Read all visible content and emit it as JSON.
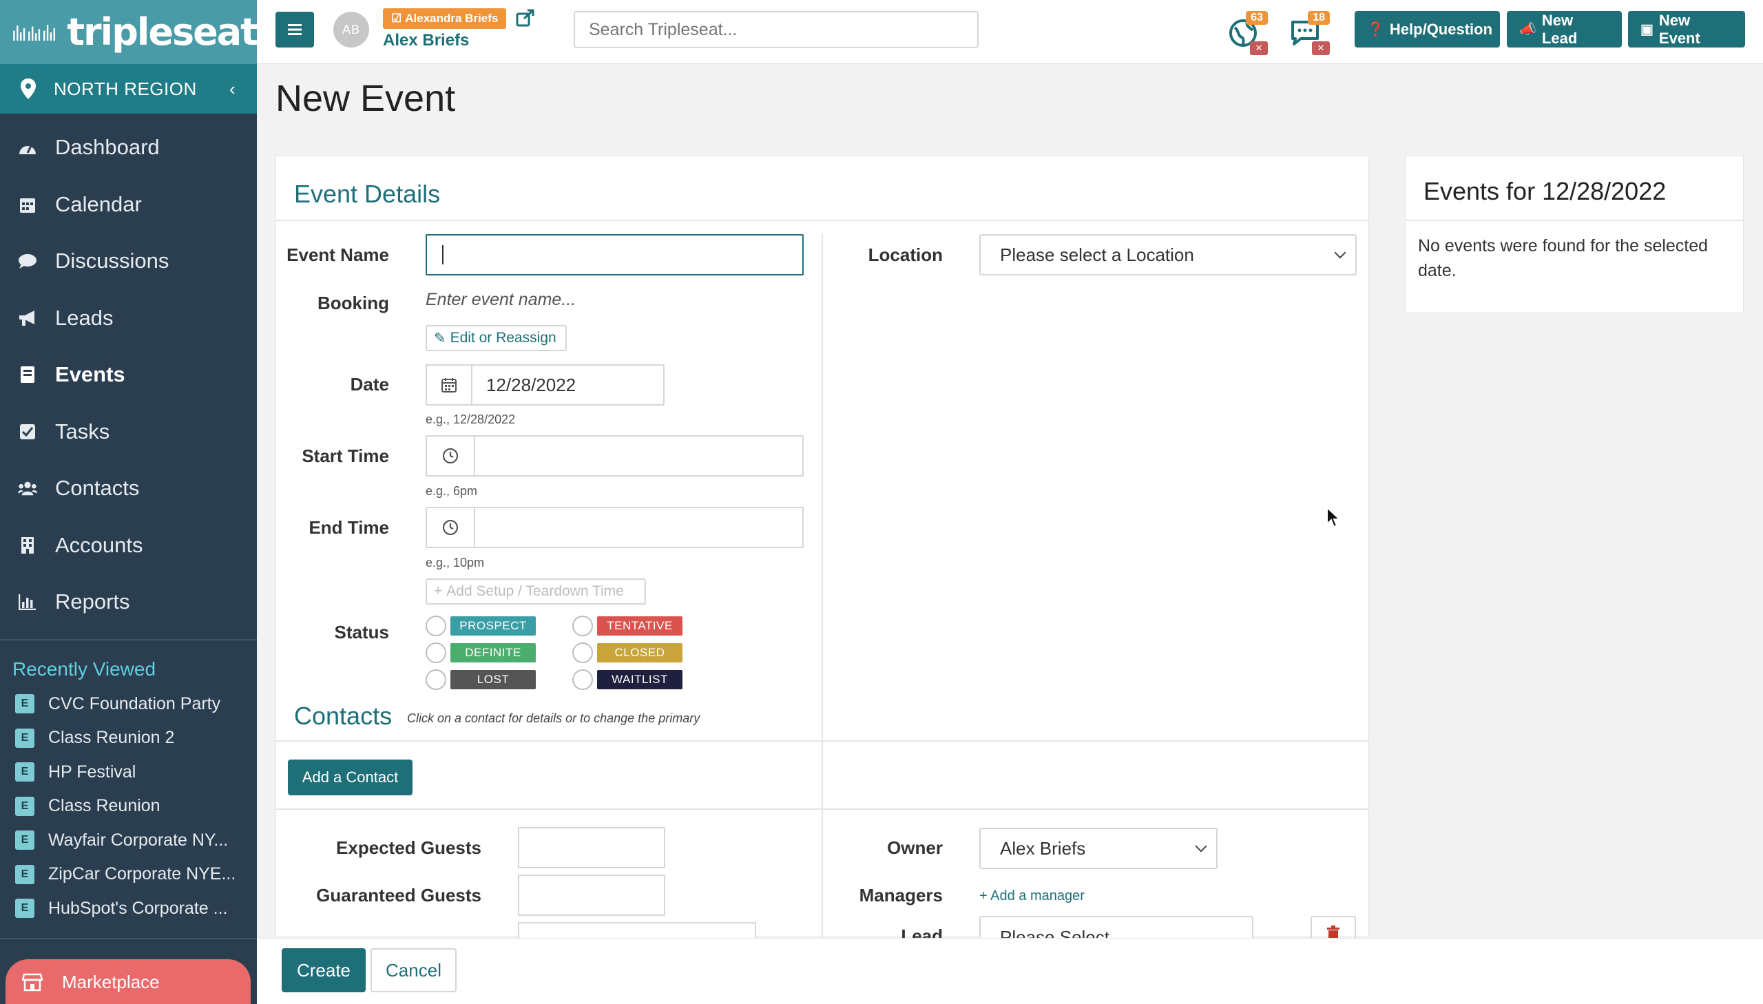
{
  "app": {
    "logo_text": "tripleseat"
  },
  "sidebar": {
    "region": "NORTH REGION",
    "items": [
      {
        "label": "Dashboard",
        "icon": "dashboard-icon"
      },
      {
        "label": "Calendar",
        "icon": "calendar-icon"
      },
      {
        "label": "Discussions",
        "icon": "chat-icon"
      },
      {
        "label": "Leads",
        "icon": "megaphone-icon"
      },
      {
        "label": "Events",
        "icon": "book-icon",
        "active": true
      },
      {
        "label": "Tasks",
        "icon": "check-square-icon"
      },
      {
        "label": "Contacts",
        "icon": "users-icon"
      },
      {
        "label": "Accounts",
        "icon": "building-icon"
      },
      {
        "label": "Reports",
        "icon": "bar-chart-icon"
      }
    ],
    "recent_title": "Recently Viewed",
    "recent": [
      {
        "badge": "E",
        "label": "CVC Foundation Party"
      },
      {
        "badge": "E",
        "label": "Class Reunion 2"
      },
      {
        "badge": "E",
        "label": "HP Festival"
      },
      {
        "badge": "E",
        "label": "Class Reunion"
      },
      {
        "badge": "E",
        "label": "Wayfair Corporate NY..."
      },
      {
        "badge": "E",
        "label": "ZipCar Corporate NYE..."
      },
      {
        "badge": "E",
        "label": "HubSpot's Corporate ..."
      }
    ],
    "marketplace": "Marketplace"
  },
  "topbar": {
    "avatar_initials": "AB",
    "user_tag": "Alexandra Briefs",
    "user_name": "Alex Briefs",
    "search_placeholder": "Search Tripleseat...",
    "notifications": {
      "globe_count": "63",
      "chat_count": "18"
    },
    "help_button": "Help/Question",
    "new_lead_button": "New Lead",
    "new_event_button": "New Event"
  },
  "page": {
    "title": "New Event"
  },
  "event_details": {
    "section_title": "Event Details",
    "event_name_label": "Event Name",
    "event_name_value": "",
    "booking_label": "Booking",
    "booking_placeholder": "Enter event name...",
    "edit_reassign": "Edit or Reassign",
    "date_label": "Date",
    "date_value": "12/28/2022",
    "date_hint": "e.g., 12/28/2022",
    "start_time_label": "Start Time",
    "start_time_hint": "e.g., 6pm",
    "end_time_label": "End Time",
    "end_time_hint": "e.g., 10pm",
    "add_setup": "Add Setup / Teardown Time",
    "status_label": "Status",
    "statuses": [
      {
        "label": "PROSPECT",
        "color": "#3a9ea5"
      },
      {
        "label": "TENTATIVE",
        "color": "#d9534f"
      },
      {
        "label": "DEFINITE",
        "color": "#4cae6c"
      },
      {
        "label": "CLOSED",
        "color": "#c9a43a"
      },
      {
        "label": "LOST",
        "color": "#555555"
      },
      {
        "label": "WAITLIST",
        "color": "#1f1f3f"
      }
    ],
    "location_label": "Location",
    "location_placeholder": "Please select a Location"
  },
  "contacts": {
    "section_title": "Contacts",
    "subtitle": "Click on a contact for details or to change the primary",
    "add_button": "Add a Contact"
  },
  "guests": {
    "expected_label": "Expected Guests",
    "guaranteed_label": "Guaranteed Guests",
    "owner_label": "Owner",
    "owner_value": "Alex Briefs",
    "managers_label": "Managers",
    "add_manager": "+ Add a manager",
    "lead_label": "Lead",
    "lead_placeholder": "Please Select"
  },
  "side_panel": {
    "title": "Events for 12/28/2022",
    "body": "No events were found for the selected date."
  },
  "footer": {
    "create": "Create",
    "cancel": "Cancel"
  },
  "colors": {
    "brand": "#1e6f78",
    "sidebar": "#2b3e50",
    "accent_orange": "#f0943a"
  }
}
